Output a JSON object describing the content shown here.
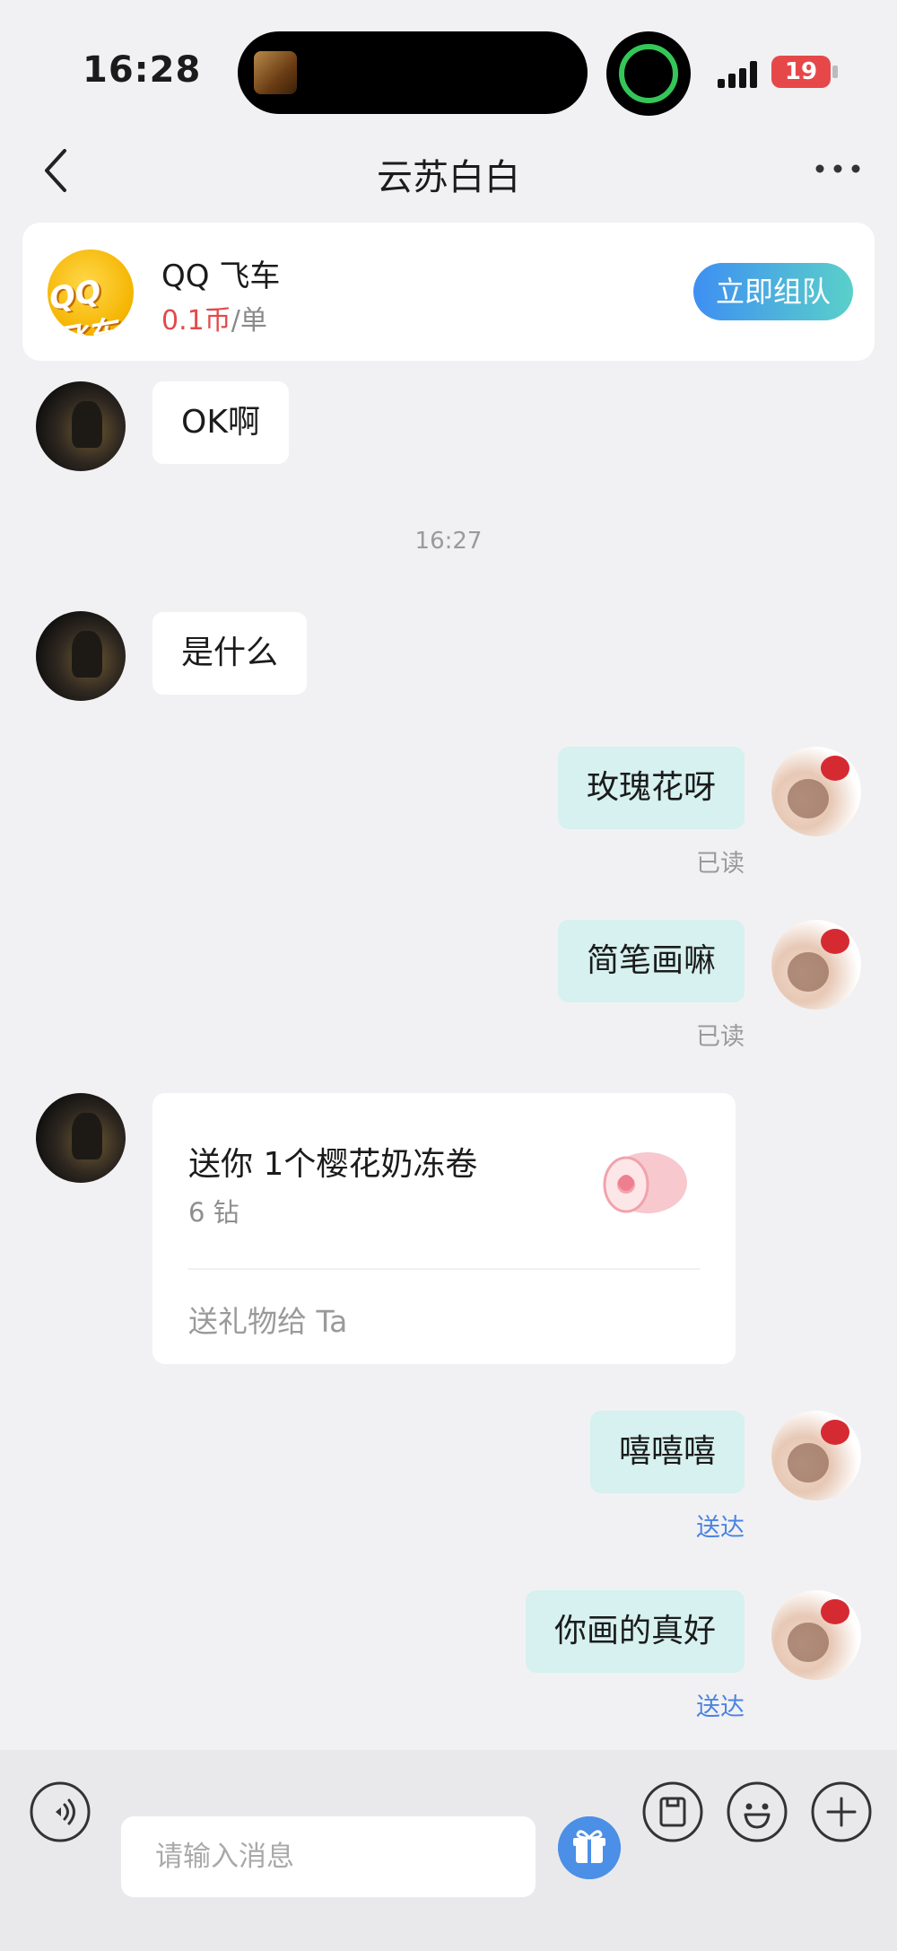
{
  "status_bar": {
    "time": "16:28",
    "battery": "19"
  },
  "header": {
    "title": "云苏白白"
  },
  "game_card": {
    "logo_text": "QQ飞车",
    "name": "QQ 飞车",
    "price_value": "0.1币",
    "price_unit": "/单",
    "button": "立即组队"
  },
  "messages": [
    {
      "side": "left",
      "text": "OK啊"
    },
    {
      "timestamp": "16:27"
    },
    {
      "side": "left",
      "text": "是什么"
    },
    {
      "side": "right",
      "text": "玫瑰花呀",
      "status": "已读"
    },
    {
      "side": "right",
      "text": "简笔画嘛",
      "status": "已读"
    },
    {
      "side": "left",
      "gift": {
        "title": "送你 1个樱花奶冻卷",
        "price": "6 钻",
        "action": "送礼物给 Ta"
      }
    },
    {
      "side": "right",
      "text": "嘻嘻嘻",
      "status": "送达"
    },
    {
      "side": "right",
      "text": "你画的真好",
      "status": "送达"
    }
  ],
  "composer": {
    "placeholder": "请输入消息"
  },
  "colors": {
    "accent": "#4b8fe6",
    "bubble_right": "#d6f1ef",
    "sent_status": "#4a84e3",
    "price_red": "#e24a4a"
  }
}
